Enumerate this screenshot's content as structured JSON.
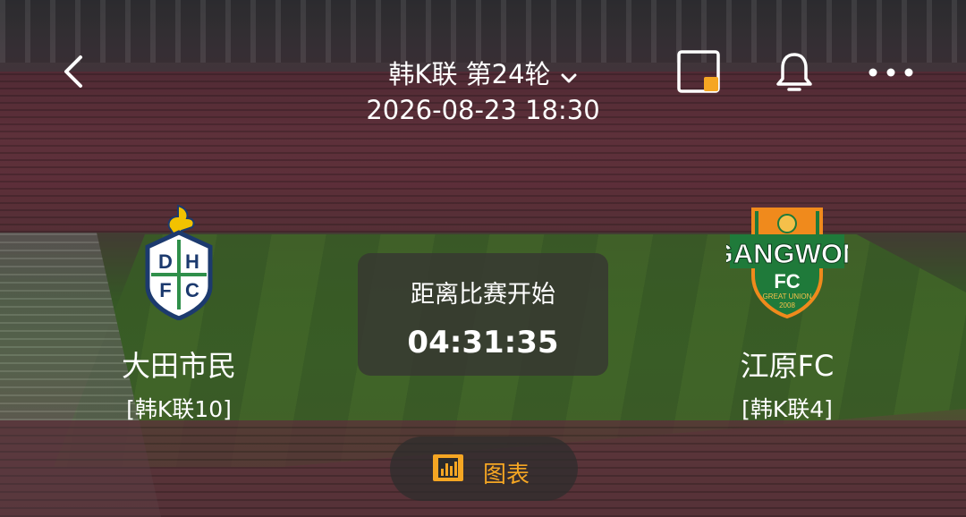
{
  "header": {
    "title": "韩K联 第24轮",
    "datetime": "2026-08-23 18:30",
    "icons": [
      "back-arrow-icon",
      "chevron-down-icon",
      "picture-in-picture-icon",
      "bell-icon",
      "more-dots-icon"
    ]
  },
  "home_team": {
    "name": "大田市民",
    "rank": "[韩K联10]",
    "logo_letters": [
      "D",
      "H",
      "F",
      "C"
    ]
  },
  "away_team": {
    "name": "江原FC",
    "rank": "[韩K联4]",
    "logo_text": "GANGWON",
    "logo_sub": "FC",
    "logo_tag": "GREAT UNION",
    "logo_year": "2008"
  },
  "countdown": {
    "label": "距离比赛开始",
    "time": "04:31:35"
  },
  "chart_button": {
    "label": "图表",
    "icon": "bar-chart-icon"
  },
  "colors": {
    "accent": "#f5a623",
    "text": "#ffffff",
    "daejeon_navy": "#1c3a6e",
    "daejeon_green": "#2f8f4a",
    "gangwon_orange": "#f08a1c",
    "gangwon_green": "#1f7a3a"
  }
}
